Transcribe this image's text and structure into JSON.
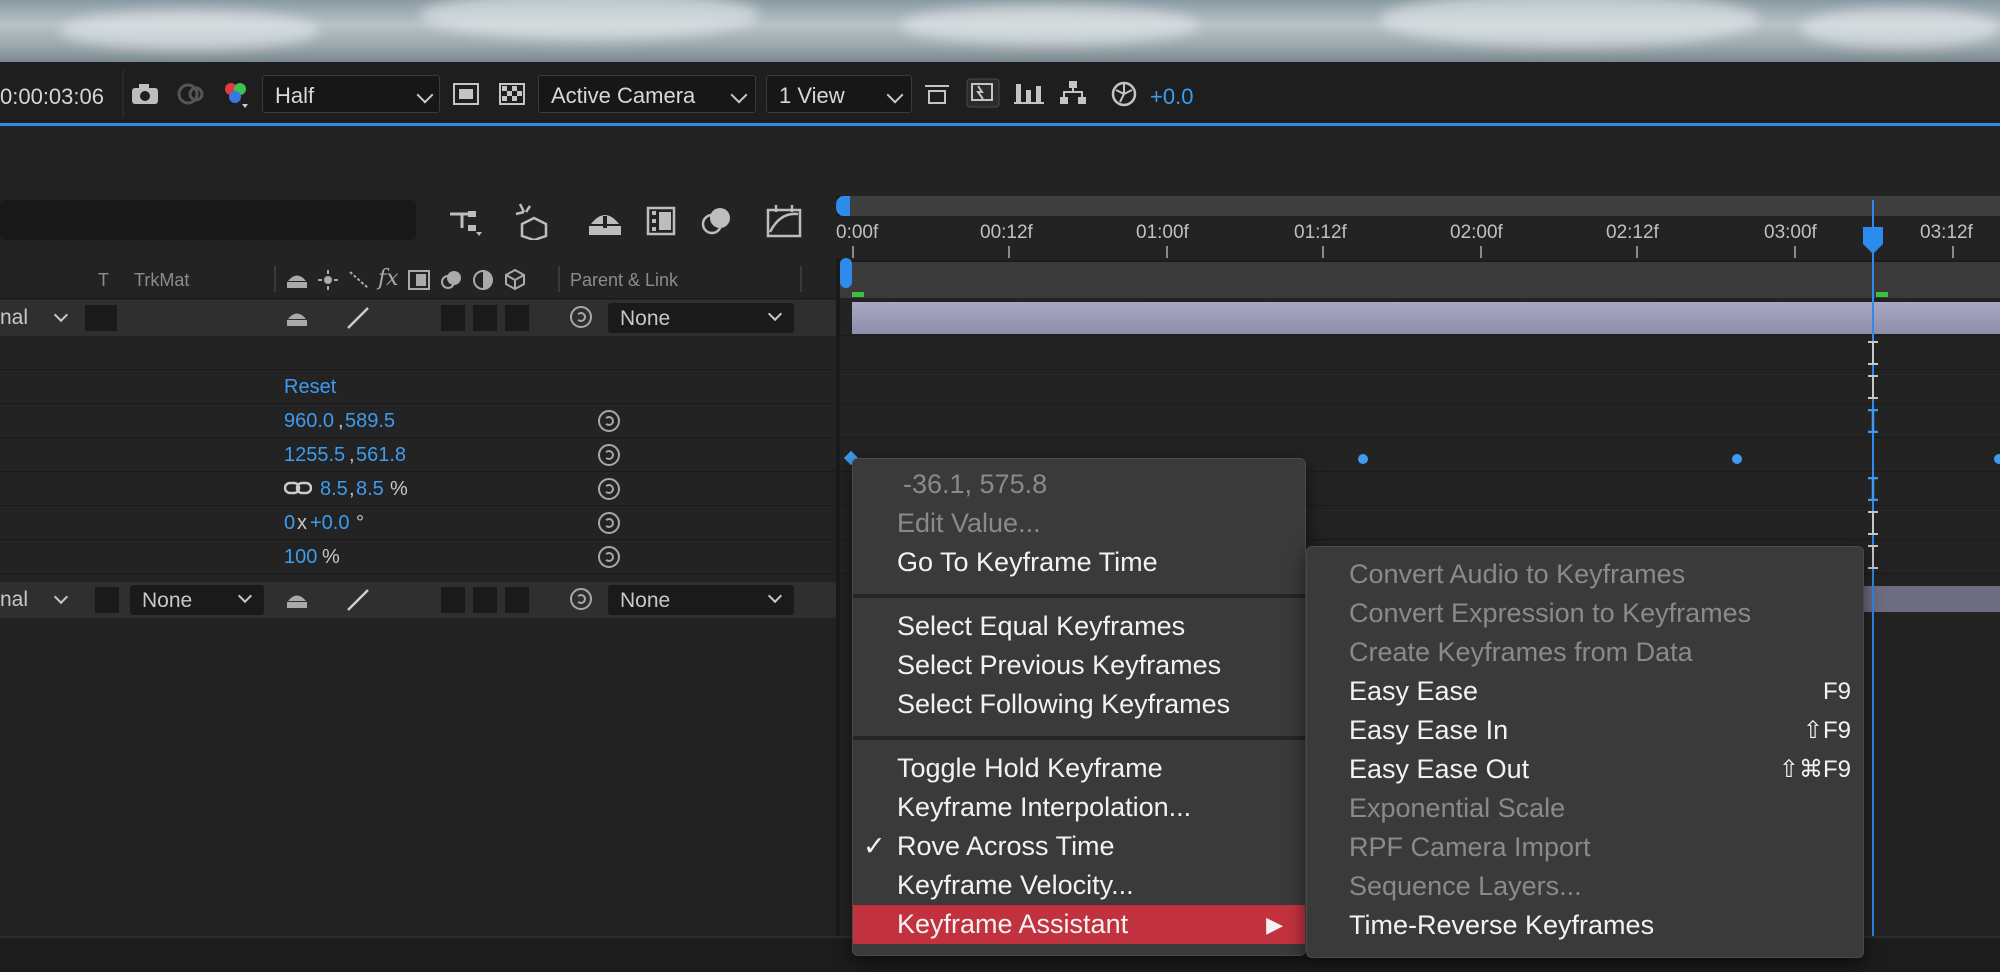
{
  "viewer_toolbar": {
    "timecode": "0:00:03:06",
    "resolution": "Half",
    "camera": "Active Camera",
    "views": "1 View",
    "exposure": "+0.0"
  },
  "timeline": {
    "columns": {
      "t": "T",
      "trkmat": "TrkMat",
      "parent_link": "Parent & Link"
    },
    "layer1": {
      "mode_trunc": "nal",
      "parent": "None"
    },
    "properties": [
      {
        "value_a": "Reset",
        "value_b": "",
        "suffix": ""
      },
      {
        "value_a": "960.0",
        "value_b": "589.5",
        "suffix": ""
      },
      {
        "value_a": "1255.5",
        "value_b": "561.8",
        "suffix": ""
      },
      {
        "value_a": "8.5",
        "value_b": "8.5",
        "suffix": "%"
      },
      {
        "value_a": "0",
        "value_b": "+0.0",
        "suffix": "°",
        "mid": "x"
      },
      {
        "value_a": "100",
        "value_b": "",
        "suffix": "%"
      }
    ],
    "layer2": {
      "mode_trunc": "nal",
      "trkmat": "None",
      "parent": "None"
    },
    "ruler_labels": [
      "0:00f",
      "00:12f",
      "01:00f",
      "01:12f",
      "02:00f",
      "02:12f",
      "03:00f",
      "03:12f"
    ]
  },
  "context_menu": {
    "header_value": "-36.1, 575.8",
    "items": {
      "edit_value": "Edit Value...",
      "go_to_keyframe_time": "Go To Keyframe Time",
      "select_equal": "Select Equal Keyframes",
      "select_previous": "Select Previous Keyframes",
      "select_following": "Select Following Keyframes",
      "toggle_hold": "Toggle Hold Keyframe",
      "interpolation": "Keyframe Interpolation...",
      "rove": "Rove Across Time",
      "rove_check": "✓",
      "velocity": "Keyframe Velocity...",
      "assistant": "Keyframe Assistant",
      "assistant_arrow": "▶"
    }
  },
  "submenu": {
    "convert_audio": "Convert Audio to Keyframes",
    "convert_expression": "Convert Expression to Keyframes",
    "create_from_data": "Create Keyframes from Data",
    "easy_ease": "Easy Ease",
    "easy_ease_shortcut": "F9",
    "easy_ease_in": "Easy Ease In",
    "easy_ease_in_shortcut": "⇧F9",
    "easy_ease_out": "Easy Ease Out",
    "easy_ease_out_shortcut": "⇧⌘F9",
    "exponential_scale": "Exponential Scale",
    "rpf_camera": "RPF Camera Import",
    "sequence_layers": "Sequence Layers...",
    "time_reverse": "Time-Reverse Keyframes"
  },
  "colors": {
    "accent_blue": "#2d8ceb",
    "menu_highlight": "#c2313e",
    "menu_bg": "#3a3a3a"
  }
}
